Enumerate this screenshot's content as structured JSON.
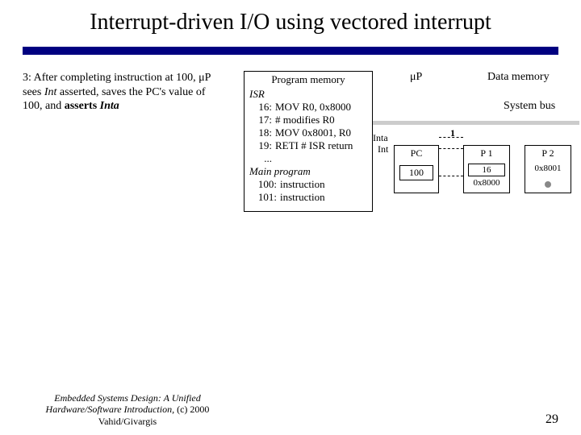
{
  "title": "Interrupt-driven I/O using vectored interrupt",
  "desc_pre": "3: After completing instruction at 100, μP sees ",
  "desc_int": "Int",
  "desc_mid": " asserted, saves the PC's value of 100, and ",
  "desc_bold": "asserts ",
  "desc_inta": "Inta",
  "progmem": {
    "header": "Program memory",
    "isr_label": "ISR",
    "rows": [
      {
        "addr": "16:",
        "txt": "MOV R0, 0x8000"
      },
      {
        "addr": "17:",
        "txt": "# modifies R0"
      },
      {
        "addr": "18:",
        "txt": "MOV 0x8001, R0"
      },
      {
        "addr": "19:",
        "txt": "RETI  # ISR return"
      }
    ],
    "main_label": "Main program",
    "main_rows": [
      {
        "addr": "100:",
        "txt": "instruction"
      },
      {
        "addr": "101:",
        "txt": "instruction"
      }
    ]
  },
  "labels": {
    "up": "μP",
    "data_mem": "Data memory",
    "system_bus": "System bus",
    "inta": "Inta",
    "int": "Int",
    "one": "1",
    "pc": "PC",
    "pc_val": "100",
    "p1": "P 1",
    "p1_reg": "16",
    "p1_val": "0x8000",
    "p2": "P 2",
    "p2_val": "0x8001"
  },
  "footer": {
    "src_line1": "Embedded Systems Design: A Unified",
    "src_line2": "Hardware/Software Introduction,",
    "src_copy": " (c) 2000 Vahid/Givargis",
    "page": "29"
  }
}
